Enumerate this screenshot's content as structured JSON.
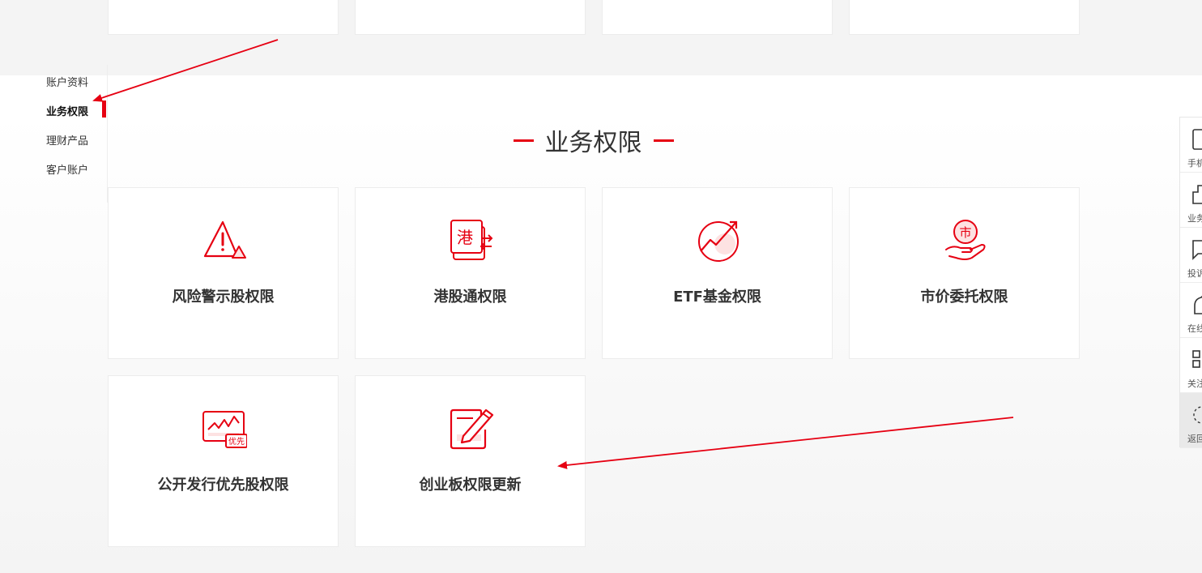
{
  "sidebar": {
    "items": [
      {
        "label": "账户资料",
        "active": false
      },
      {
        "label": "业务权限",
        "active": true
      },
      {
        "label": "理财产品",
        "active": false
      },
      {
        "label": "客户账户",
        "active": false
      }
    ]
  },
  "section": {
    "title": "业务权限"
  },
  "permissions": [
    {
      "label": "风险警示股权限",
      "icon": "warning-triangle-icon"
    },
    {
      "label": "港股通权限",
      "icon": "hk-connect-icon"
    },
    {
      "label": "ETF基金权限",
      "icon": "etf-trend-icon"
    },
    {
      "label": "市价委托权限",
      "icon": "market-order-hand-icon"
    },
    {
      "label": "公开发行优先股权限",
      "icon": "preferred-stock-chart-icon"
    },
    {
      "label": "创业板权限更新",
      "icon": "edit-document-icon"
    }
  ],
  "icon_text": {
    "hk": "港",
    "market": "市",
    "preferred": "优先"
  },
  "right_panel": {
    "items": [
      {
        "label": "手机",
        "icon": "phone-icon"
      },
      {
        "label": "业务",
        "icon": "business-icon"
      },
      {
        "label": "投诉",
        "icon": "complaint-icon"
      },
      {
        "label": "在线",
        "icon": "online-service-icon"
      },
      {
        "label": "关注",
        "icon": "qr-code-icon"
      },
      {
        "label": "返回",
        "icon": "back-to-top-icon"
      }
    ]
  },
  "colors": {
    "accent": "#e60012",
    "text": "#333333",
    "background": "#f4f4f4"
  }
}
